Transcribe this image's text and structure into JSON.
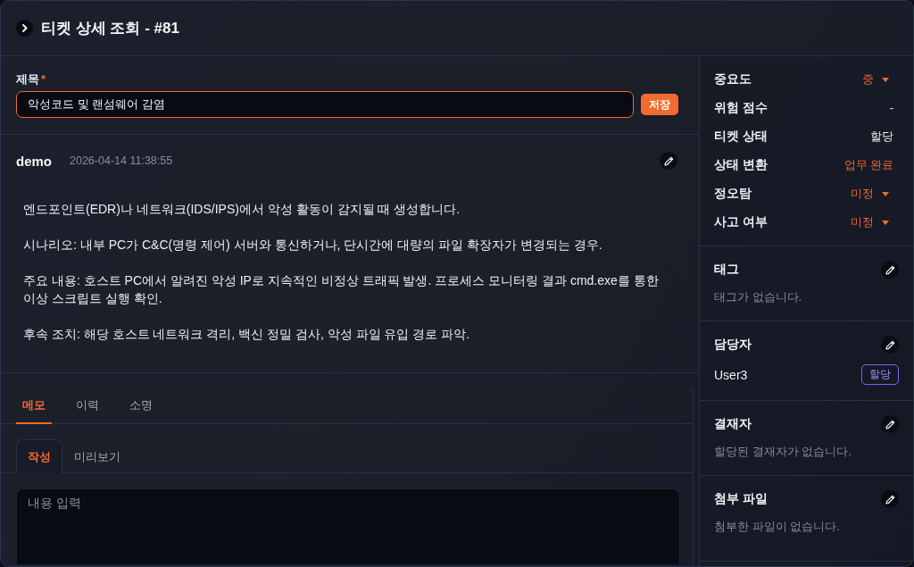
{
  "header": {
    "title": "티켓 상세 조회 - #81"
  },
  "title_field": {
    "label": "제목",
    "required_mark": "*",
    "value": "악성코드 및 랜섬웨어 감염",
    "save_button": "저장"
  },
  "comment": {
    "author": "demo",
    "timestamp": "2026-04-14 11:38:55",
    "paragraphs": [
      "엔드포인트(EDR)나 네트워크(IDS/IPS)에서 악성 활동이 감지될 때 생성합니다.",
      "시나리오: 내부 PC가 C&C(명령 제어) 서버와 통신하거나, 단시간에 대량의 파일 확장자가 변경되는 경우.",
      "주요 내용: 호스트 PC에서 알려진 악성 IP로 지속적인 비정상 트래픽 발생. 프로세스 모니터링 결과 cmd.exe를 통한 이상 스크립트 실행 확인.",
      "후속 조치: 해당 호스트 네트워크 격리, 백신 정밀 검사, 악성 파일 유입 경로 파악."
    ]
  },
  "tabs": [
    {
      "label": "메모",
      "selected": true
    },
    {
      "label": "이력",
      "selected": false
    },
    {
      "label": "소명",
      "selected": false
    }
  ],
  "editor_tabs": [
    {
      "label": "작성",
      "selected": true
    },
    {
      "label": "미리보기",
      "selected": false
    }
  ],
  "memo_field": {
    "placeholder": "내용 입력"
  },
  "properties": [
    {
      "label": "중요도",
      "value": "중",
      "kind": "dropdown"
    },
    {
      "label": "위험 점수",
      "value": "-",
      "kind": "text"
    },
    {
      "label": "티켓 상태",
      "value": "할당",
      "kind": "text"
    },
    {
      "label": "상태 변환",
      "value": "업무 완료",
      "kind": "action"
    },
    {
      "label": "정오탐",
      "value": "미정",
      "kind": "dropdown"
    },
    {
      "label": "사고 여부",
      "value": "미정",
      "kind": "dropdown"
    }
  ],
  "sections": [
    {
      "title": "태그",
      "empty_text": "태그가 없습니다."
    },
    {
      "title": "담당자",
      "people": [
        {
          "name": "User3",
          "badge": "할당"
        }
      ]
    },
    {
      "title": "결재자",
      "empty_text": "할당된 결재자가 없습니다."
    },
    {
      "title": "첨부 파일",
      "empty_text": "첨부한 파일이 없습니다."
    }
  ]
}
